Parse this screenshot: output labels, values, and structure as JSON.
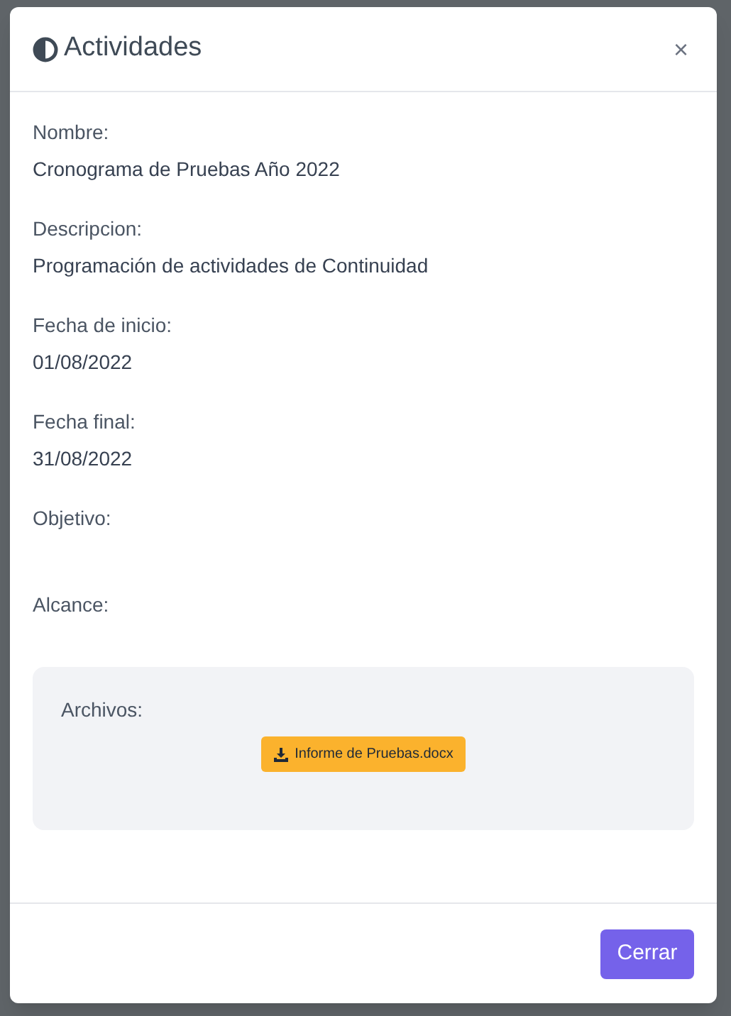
{
  "dialog": {
    "title": "Actividades",
    "close": "×"
  },
  "fields": [
    {
      "label": "Nombre:",
      "value": "Cronograma de Pruebas Año 2022"
    },
    {
      "label": "Descripcion:",
      "value": "Programación de actividades de Continuidad"
    },
    {
      "label": "Fecha de inicio:",
      "value": "01/08/2022"
    },
    {
      "label": "Fecha final:",
      "value": "31/08/2022"
    },
    {
      "label": "Objetivo:"
    },
    {
      "label": "Alcance:"
    }
  ],
  "files": {
    "label": "Archivos:",
    "items": [
      "Informe de Pruebas.docx"
    ]
  },
  "footer": {
    "button": "Cerrar"
  }
}
